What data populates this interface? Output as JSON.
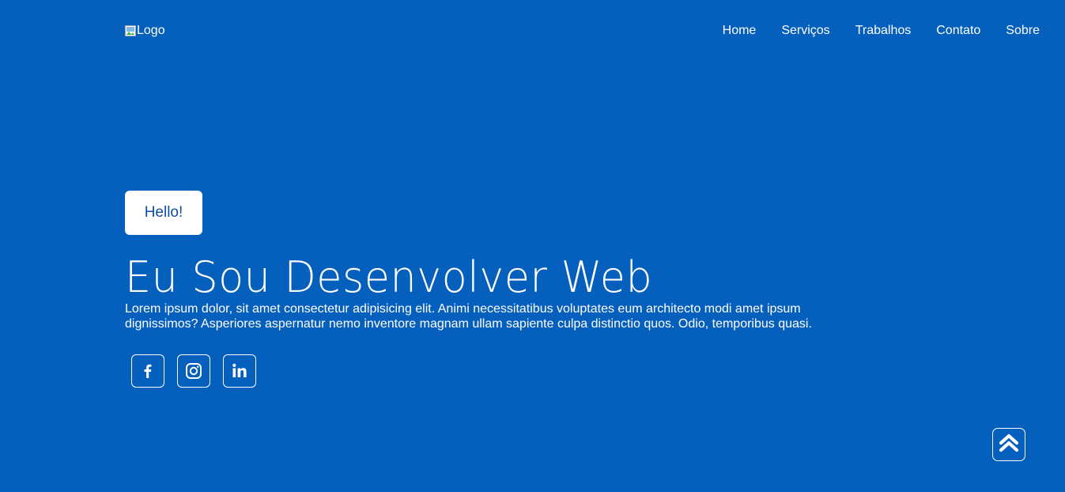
{
  "header": {
    "logo_alt": "Logo",
    "nav": [
      {
        "label": "Home"
      },
      {
        "label": "Serviços"
      },
      {
        "label": "Trabalhos"
      },
      {
        "label": "Contato"
      },
      {
        "label": "Sobre"
      }
    ]
  },
  "hero": {
    "badge": "Hello!",
    "title": "Eu Sou Desenvolver Web",
    "description": "Lorem ipsum dolor, sit amet consectetur adipisicing elit. Animi necessitatibus voluptates eum architecto modi amet ipsum dignissimos? Asperiores aspernatur nemo inventore magnam ullam sapiente culpa distinctio quos. Odio, temporibus quasi."
  },
  "socials": [
    {
      "icon": "facebook-icon"
    },
    {
      "icon": "instagram-icon"
    },
    {
      "icon": "linkedin-icon"
    }
  ],
  "scroll_top": {
    "icon": "double-chevron-up-icon"
  },
  "colors": {
    "background": "#055fbd",
    "badge_text": "#0b4d9e",
    "foreground": "#ffffff"
  }
}
